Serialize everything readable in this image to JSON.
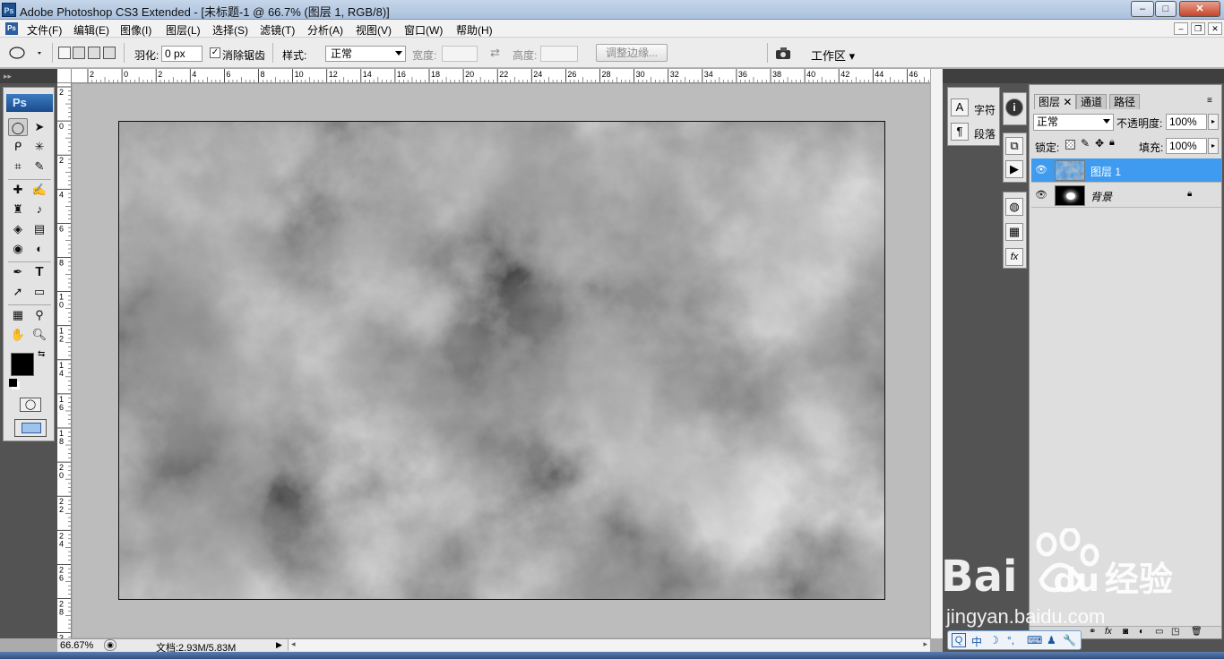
{
  "window": {
    "title": "Adobe Photoshop CS3 Extended - [未标题-1 @ 66.7% (图层 1, RGB/8)]",
    "app_icon": "Ps",
    "buttons": {
      "minimize": "–",
      "maximize": "□",
      "close": "✕"
    }
  },
  "menubar": {
    "doc_icon": "Ps",
    "items": [
      "文件(F)",
      "编辑(E)",
      "图像(I)",
      "图层(L)",
      "选择(S)",
      "滤镜(T)",
      "分析(A)",
      "视图(V)",
      "窗口(W)",
      "帮助(H)"
    ],
    "doc_buttons": {
      "minimize": "–",
      "restore": "❐",
      "close": "✕"
    }
  },
  "options_bar": {
    "tool_icon": "elliptical-marquee-icon",
    "feather_label": "羽化:",
    "feather_value": "0 px",
    "antialias_label": "消除锯齿",
    "antialias_checked": true,
    "style_label": "样式:",
    "style_value": "正常",
    "width_label": "宽度:",
    "height_label": "高度:",
    "refine_edge_label": "调整边缘...",
    "workspace_label": "工作区"
  },
  "rulers": {
    "horizontal": [
      "2",
      "0",
      "2",
      "4",
      "6",
      "8",
      "10",
      "12",
      "14",
      "16",
      "18",
      "20",
      "22",
      "24",
      "26",
      "28",
      "30",
      "32",
      "34",
      "36",
      "38",
      "40",
      "42",
      "44",
      "46"
    ],
    "vertical": [
      "2",
      "0",
      "2",
      "4",
      "6",
      "8",
      "1\n0",
      "1\n2",
      "1\n4",
      "1\n6",
      "1\n8",
      "2\n0",
      "2\n2",
      "2\n4",
      "2\n6",
      "2\n8",
      "3"
    ]
  },
  "toolbox": {
    "badge": "Ps"
  },
  "statusbar": {
    "zoom": "66.67%",
    "doc_info": "文档:2.93M/5.83M"
  },
  "side_panels": {
    "character_label": "字符",
    "paragraph_label": "段落"
  },
  "layers_panel": {
    "tabs": [
      "图层",
      "通道",
      "路径"
    ],
    "blend_mode": "正常",
    "opacity_label": "不透明度:",
    "opacity_value": "100%",
    "lock_label": "锁定:",
    "fill_label": "填充:",
    "fill_value": "100%",
    "layers": [
      {
        "name": "图层 1",
        "selected": true,
        "visible": true,
        "locked": false
      },
      {
        "name": "背景",
        "selected": false,
        "visible": true,
        "locked": true
      }
    ]
  },
  "watermark": {
    "brand": "Bai",
    "brand_tail": "du",
    "product": "经验",
    "url": "jingyan.baidu.com"
  },
  "ime_bar": {
    "items": [
      "中",
      "☽",
      "°,",
      "⌨",
      "♟",
      "🔧"
    ]
  }
}
